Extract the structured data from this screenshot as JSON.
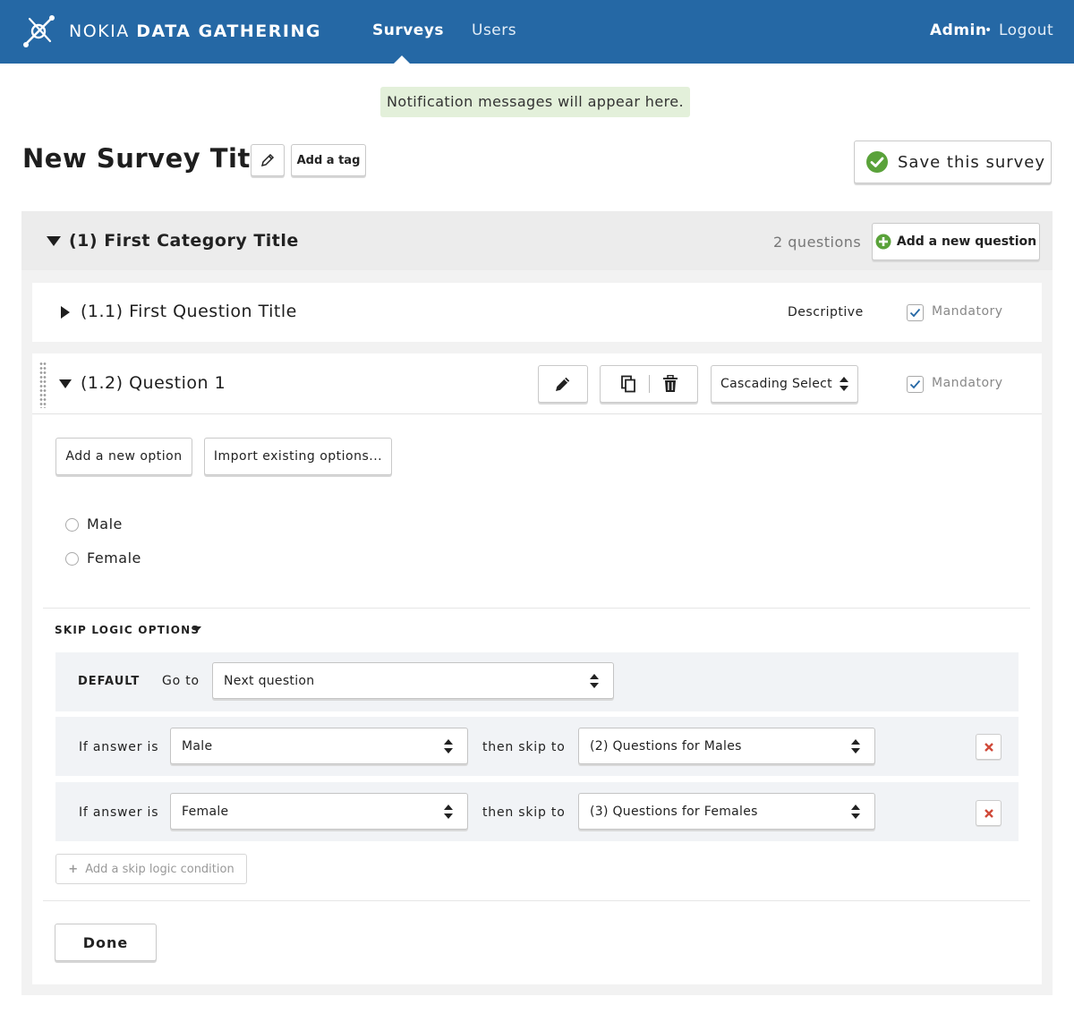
{
  "colors": {
    "nav_bg": "#2568a5",
    "notice_bg": "#e3f0da",
    "accent_green": "#5aa23a",
    "danger": "#d04a3a"
  },
  "nav": {
    "brand_light": "NOKIA ",
    "brand_bold": "DATA GATHERING",
    "items": [
      {
        "label": "Surveys",
        "active": true
      },
      {
        "label": "Users",
        "active": false
      }
    ],
    "user": "Admin",
    "separator": "•",
    "logout": "Logout"
  },
  "notification": "Notification messages will appear here.",
  "survey": {
    "title": "New Survey Title",
    "add_tag": "Add a tag",
    "save": "Save this survey"
  },
  "category": {
    "title": "(1) First Category Title",
    "count": "2 questions",
    "add_question": "Add a new question",
    "questions": [
      {
        "title": "(1.1) First Question Title",
        "type": "Descriptive",
        "mandatory_label": "Mandatory",
        "mandatory": true,
        "expanded": false
      },
      {
        "title": "(1.2) Question 1",
        "type": "Cascading Select",
        "mandatory_label": "Mandatory",
        "mandatory": true,
        "expanded": true
      }
    ]
  },
  "editor": {
    "add_option": "Add a new option",
    "import_options": "Import existing options...",
    "options": [
      "Male",
      "Female"
    ],
    "skip_logic": {
      "title": "SKIP LOGIC OPTIONS",
      "default_label": "DEFAULT",
      "goto_label": "Go to",
      "default_target": "Next question",
      "rules": [
        {
          "if_label": "If answer is",
          "answer": "Male",
          "then_label": "then skip to",
          "target": "(2) Questions for Males"
        },
        {
          "if_label": "If answer is",
          "answer": "Female",
          "then_label": "then skip to",
          "target": "(3) Questions for Females"
        }
      ],
      "add_condition": "Add a skip logic condition"
    },
    "done": "Done"
  }
}
